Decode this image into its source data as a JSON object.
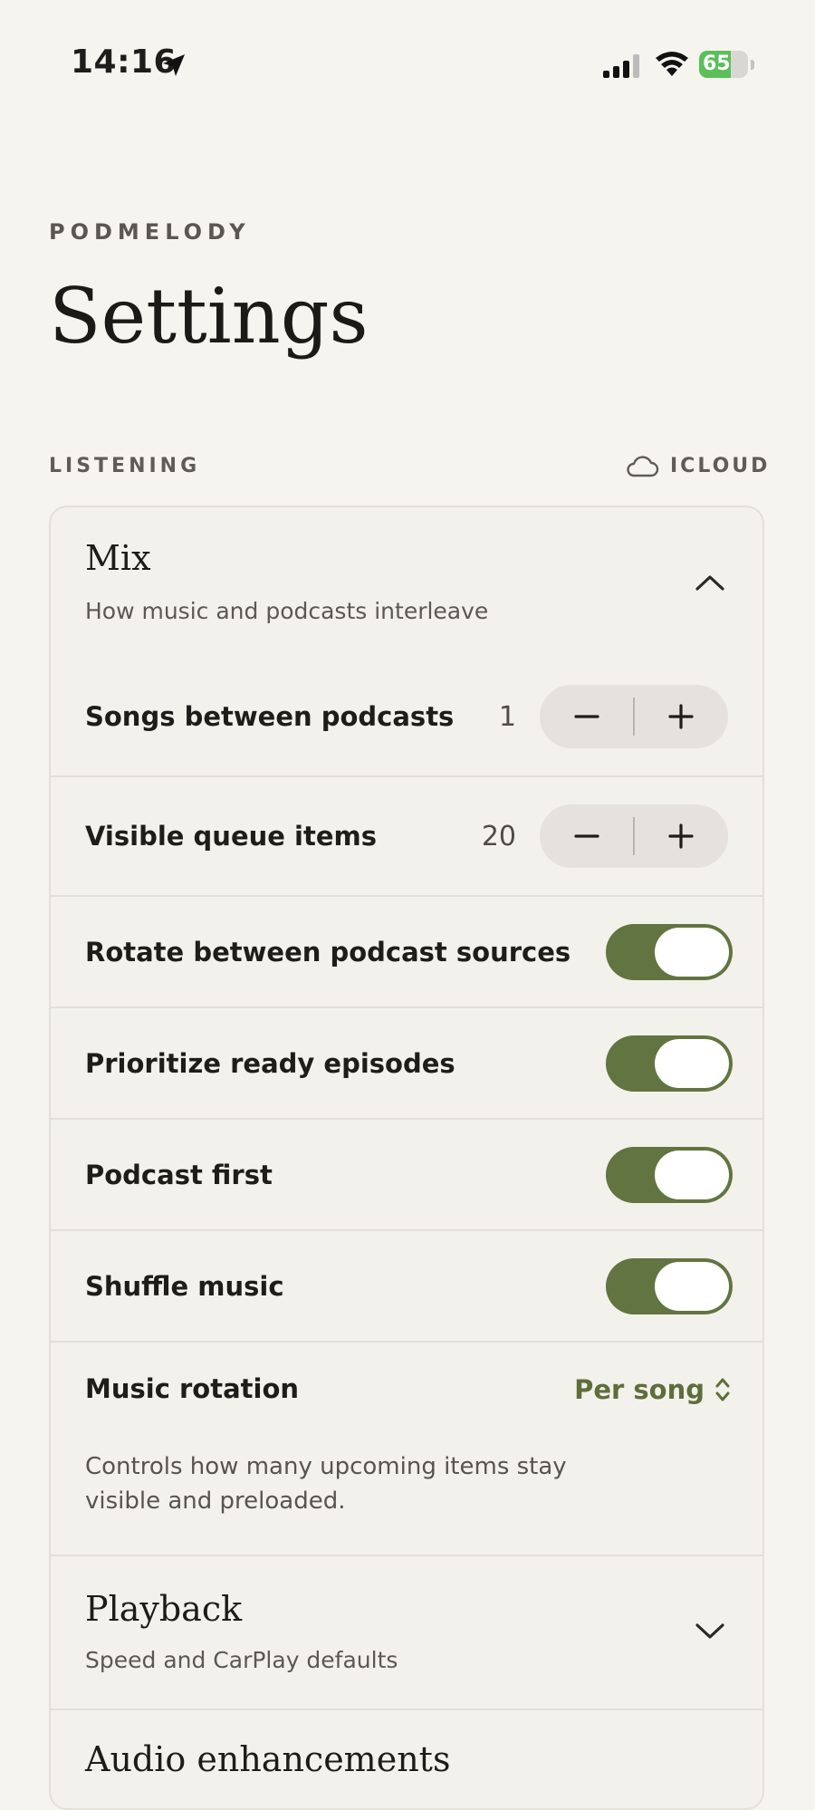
{
  "status_bar": {
    "time": "14:16",
    "battery": "65",
    "battery_level": 0.65
  },
  "header": {
    "brand": "PODMELODY",
    "title": "Settings"
  },
  "section": {
    "label": "LISTENING",
    "sync_label": "ICLOUD"
  },
  "mix": {
    "title": "Mix",
    "subtitle": "How music and podcasts interleave",
    "songs_between_podcasts": {
      "label": "Songs between podcasts",
      "value": "1"
    },
    "visible_queue_items": {
      "label": "Visible queue items",
      "value": "20"
    },
    "toggles": [
      {
        "label": "Rotate between podcast sources",
        "on": true
      },
      {
        "label": "Prioritize ready episodes",
        "on": true
      },
      {
        "label": "Podcast first",
        "on": true
      },
      {
        "label": "Shuffle music",
        "on": true
      }
    ],
    "music_rotation": {
      "label": "Music rotation",
      "value": "Per song"
    },
    "helper": "Controls how many upcoming items stay visible and preloaded."
  },
  "playback": {
    "title": "Playback",
    "subtitle": "Speed and CarPlay defaults"
  },
  "audio": {
    "title": "Audio enhancements"
  },
  "colors": {
    "accent": "#627440",
    "background": "#f6f4ef",
    "battery": "#5cbf5a"
  }
}
